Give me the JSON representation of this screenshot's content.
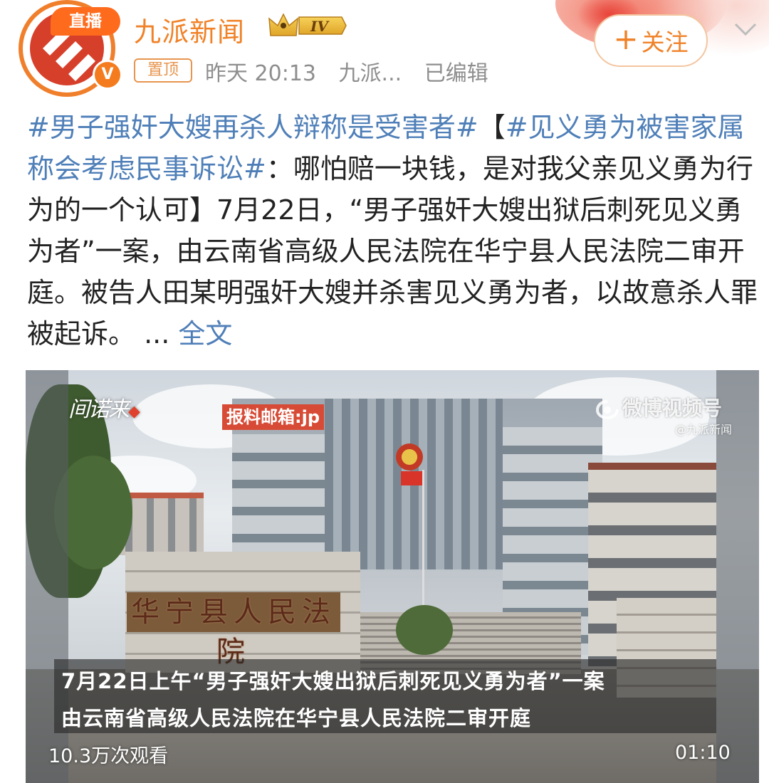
{
  "header": {
    "live_label": "直播",
    "author_name": "九派新闻",
    "level_label": "IV",
    "pin_label": "置顶",
    "time": "昨天 20:13",
    "source": "九派...",
    "edited": "已编辑",
    "follow_label": "关注",
    "verified_mark": "V"
  },
  "post": {
    "hashtag_1": "#男子强奸大嫂再杀人辩称是受害者#",
    "bracket_open": "【",
    "hashtag_2": "#见义勇为被害家属称会考虑民事诉讼#",
    "body": "：哪怕赔一块钱，是对我父亲见义勇为行为的一个认可】7月22日，“男子强奸大嫂出狱后刺死见义勇为者”一案，由云南省高级人民法院在华宁县人民法院二审开庭。被告人田某明强奸大嫂并杀害见义勇为者，以故意杀人罪被起诉。",
    "ellipsis": " ... ",
    "full_text_link": "全文"
  },
  "video": {
    "logo_text": "间诺来",
    "mail_tag": "报料邮箱:jp",
    "watermark": "微博视频号",
    "watermark_source": "@九派新闻",
    "gate_sign": "华宁县人民法院",
    "caption_line_1": "7月22日上午“男子强奸大嫂出狱后刺死见义勇为者”一案",
    "caption_line_2": "由云南省高级人民法院在华宁县人民法院二审开庭",
    "views": "10.3万次观看",
    "duration": "01:10"
  },
  "colors": {
    "accent_orange": "#f08228",
    "hashtag_blue": "#4f7fb8",
    "meta_gray": "#8e8e8e"
  },
  "icons": {
    "follow": "plus-icon",
    "more": "chevron-down-icon",
    "level": "crown-icon"
  }
}
